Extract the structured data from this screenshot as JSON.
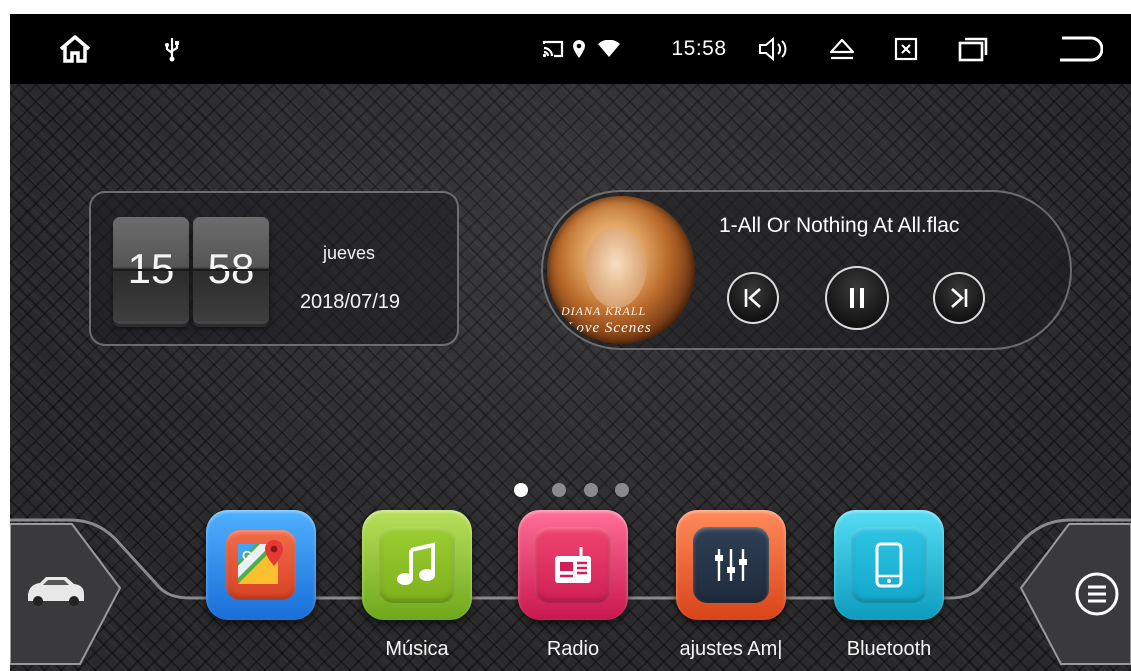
{
  "status_bar": {
    "time": "15:58",
    "icons": [
      "home-icon",
      "usb-icon",
      "cast-icon",
      "location-icon",
      "wifi-icon",
      "volume-icon",
      "eject-icon",
      "close-app-icon",
      "recent-apps-icon",
      "back-icon"
    ]
  },
  "clock_widget": {
    "hours": "15",
    "minutes": "58",
    "weekday": "jueves",
    "date": "2018/07/19"
  },
  "music_widget": {
    "track_title": "1-All Or Nothing At All.flac",
    "album_caption": "DIANA KRALL",
    "album_caption_script": "Love Scenes",
    "controls": [
      "previous-icon",
      "pause-icon",
      "next-icon"
    ]
  },
  "pager": {
    "pages": 4,
    "current": 1
  },
  "dock": {
    "apps": [
      {
        "icon": "maps-icon",
        "label": ""
      },
      {
        "icon": "music-note-icon",
        "label": "Música"
      },
      {
        "icon": "radio-icon",
        "label": "Radio"
      },
      {
        "icon": "equalizer-icon",
        "label": "ajustes Am|"
      },
      {
        "icon": "phone-icon",
        "label": "Bluetooth"
      }
    ],
    "left_button_icon": "car-icon",
    "right_button_icon": "menu-icon"
  },
  "colors": {
    "maps_frame": "#2a88e8",
    "music": "#8cbf2a",
    "radio": "#e2306a",
    "amp": "#ee5a2a",
    "bluetooth": "#17b8d9"
  }
}
